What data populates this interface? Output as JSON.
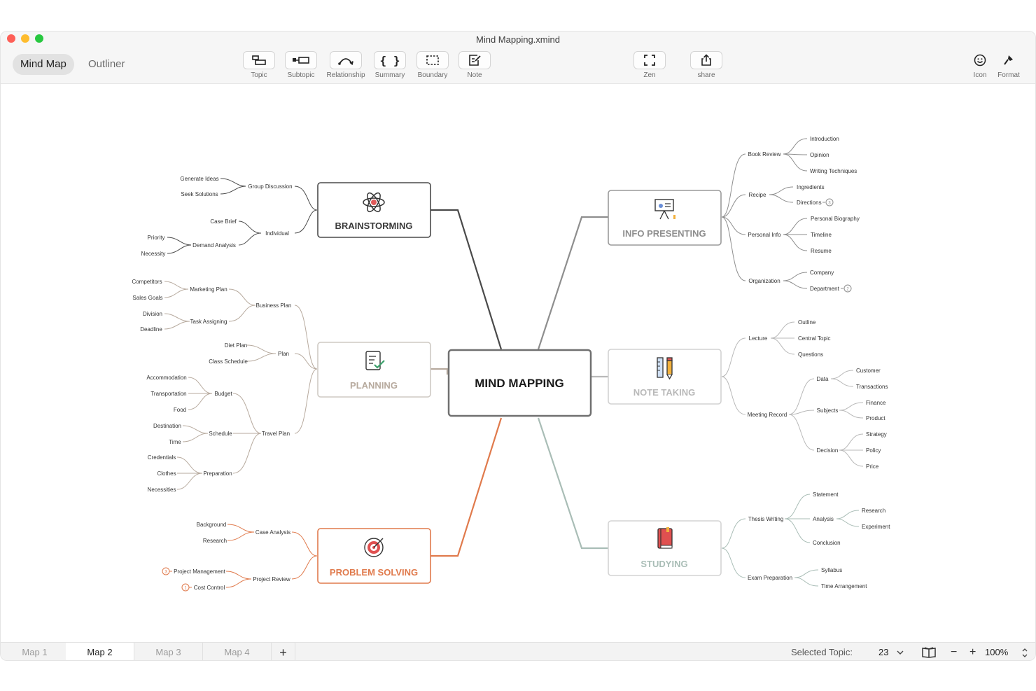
{
  "window": {
    "title": "Mind Mapping.xmind"
  },
  "view_switch": {
    "mindmap": "Mind Map",
    "outliner": "Outliner"
  },
  "toolbar": {
    "topic": "Topic",
    "subtopic": "Subtopic",
    "relationship": "Relationship",
    "summary": "Summary",
    "boundary": "Boundary",
    "note": "Note",
    "zen": "Zen",
    "share": "share",
    "icon": "Icon",
    "format": "Format"
  },
  "map": {
    "central": "MIND MAPPING",
    "brainstorming": {
      "title": "BRAINSTORMING",
      "group_discussion": "Group Discussion",
      "generate_ideas": "Generate Ideas",
      "seek_solutions": "Seek Solutions",
      "individual": "Individual",
      "case_brief": "Case Brief",
      "demand_analysis": "Demand Analysis",
      "priority": "Priority",
      "necessity": "Necessity"
    },
    "planning": {
      "title": "PLANNING",
      "business_plan": "Business Plan",
      "marketing_plan": "Marketing Plan",
      "competitors": "Competitors",
      "sales_goals": "Sales Goals",
      "task_assigning": "Task Assigning",
      "division": "Division",
      "deadline": "Deadline",
      "plan": "Plan",
      "diet_plan": "Diet Plan",
      "class_schedule": "Class Schedule",
      "travel_plan": "Travel Plan",
      "budget": "Budget",
      "accommodation": "Accommodation",
      "transportation": "Transportation",
      "food": "Food",
      "schedule": "Schedule",
      "destination": "Destination",
      "time": "Time",
      "preparation": "Preparation",
      "credentials": "Credentials",
      "clothes": "Clothes",
      "necessities": "Necessities"
    },
    "problem_solving": {
      "title": "PROBLEM SOLVING",
      "case_analysis": "Case Analysis",
      "background": "Background",
      "research": "Research",
      "project_review": "Project Review",
      "project_management": "Project Management",
      "cost_control": "Cost Control",
      "badge_pm": "3",
      "badge_cc": "1"
    },
    "info_presenting": {
      "title": "INFO PRESENTING",
      "book_review": "Book Review",
      "introduction": "Introduction",
      "opinion": "Opinion",
      "writing_techniques": "Writing Techniques",
      "recipe": "Recipe",
      "ingredients": "Ingredients",
      "directions": "Directions",
      "badge_directions": "3",
      "personal_info": "Personal Info",
      "personal_biography": "Personal Biography",
      "timeline": "Timeline",
      "resume": "Resume",
      "organization": "Organization",
      "company": "Company",
      "department": "Department",
      "badge_department": "2"
    },
    "note_taking": {
      "title": "NOTE TAKING",
      "lecture": "Lecture",
      "outline": "Outline",
      "central_topic": "Central Topic",
      "questions": "Questions",
      "meeting_record": "Meeting Record",
      "data": "Data",
      "customer": "Customer",
      "transactions": "Transactions",
      "subjects": "Subjects",
      "finance": "Finance",
      "product": "Product",
      "decision": "Decision",
      "strategy": "Strategy",
      "policy": "Policy",
      "price": "Price"
    },
    "studying": {
      "title": "STUDYING",
      "thesis_writing": "Thesis Writing",
      "statement": "Statement",
      "analysis": "Analysis",
      "research": "Research",
      "experiment": "Experiment",
      "conclusion": "Conclusion",
      "exam_preparation": "Exam Preparation",
      "syllabus": "Syllabus",
      "time_arrangement": "Time Arrangement"
    }
  },
  "bottom": {
    "tabs": [
      "Map 1",
      "Map 2",
      "Map 3",
      "Map 4"
    ],
    "add": "+",
    "selected_label": "Selected Topic:",
    "selected_value": "23",
    "zoom": "100%",
    "zoom_out": "−",
    "zoom_in": "+"
  },
  "colors": {
    "brainstorming": "#4a4a4a",
    "planning": "#b7aa9e",
    "problem_solving": "#e07a4c",
    "info_presenting": "#8e8e8e",
    "note_taking": "#b9b9b9",
    "studying": "#a9bdb6"
  }
}
